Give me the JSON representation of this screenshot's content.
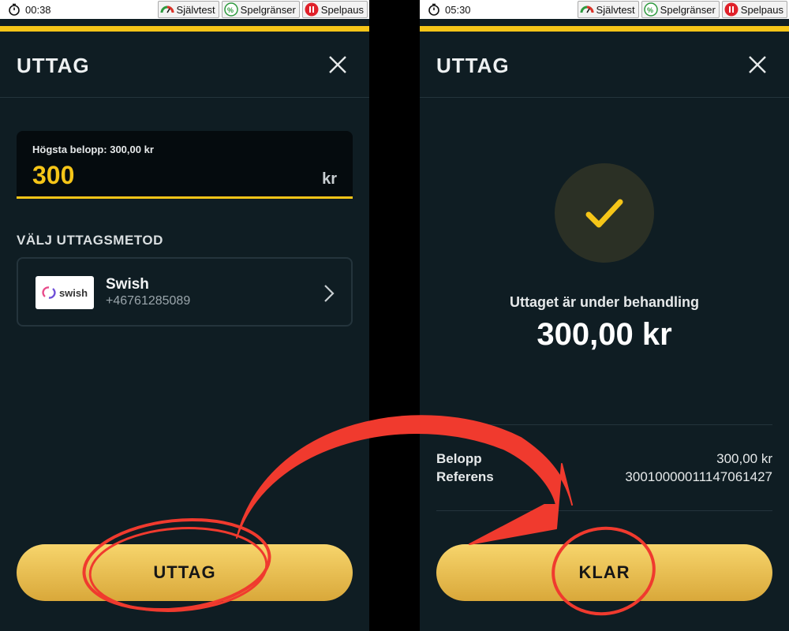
{
  "left": {
    "status": {
      "time": "00:38",
      "buttons": [
        {
          "label": "Självtest"
        },
        {
          "label": "Spelgränser"
        },
        {
          "label": "Spelpaus"
        }
      ]
    },
    "title": "UTTAG",
    "amount": {
      "max_label": "Högsta belopp: 300,00 kr",
      "value": "300",
      "currency": "kr"
    },
    "section_title": "VÄLJ UTTAGSMETOD",
    "method": {
      "logo_text": "swish",
      "name": "Swish",
      "phone": "+46761285089"
    },
    "cta_label": "UTTAG"
  },
  "right": {
    "status": {
      "time": "05:30",
      "buttons": [
        {
          "label": "Självtest"
        },
        {
          "label": "Spelgränser"
        },
        {
          "label": "Spelpaus"
        }
      ]
    },
    "title": "UTTAG",
    "status_text": "Uttaget är under behandling",
    "amount": "300,00 kr",
    "details": [
      {
        "label": "Belopp",
        "value": "300,00 kr"
      },
      {
        "label": "Referens",
        "value": "3001000001114706142​7"
      }
    ],
    "cta_label": "KLAR"
  },
  "colors": {
    "accent": "#f5c518",
    "background": "#0f1d23",
    "annotation": "#f03a2e"
  }
}
